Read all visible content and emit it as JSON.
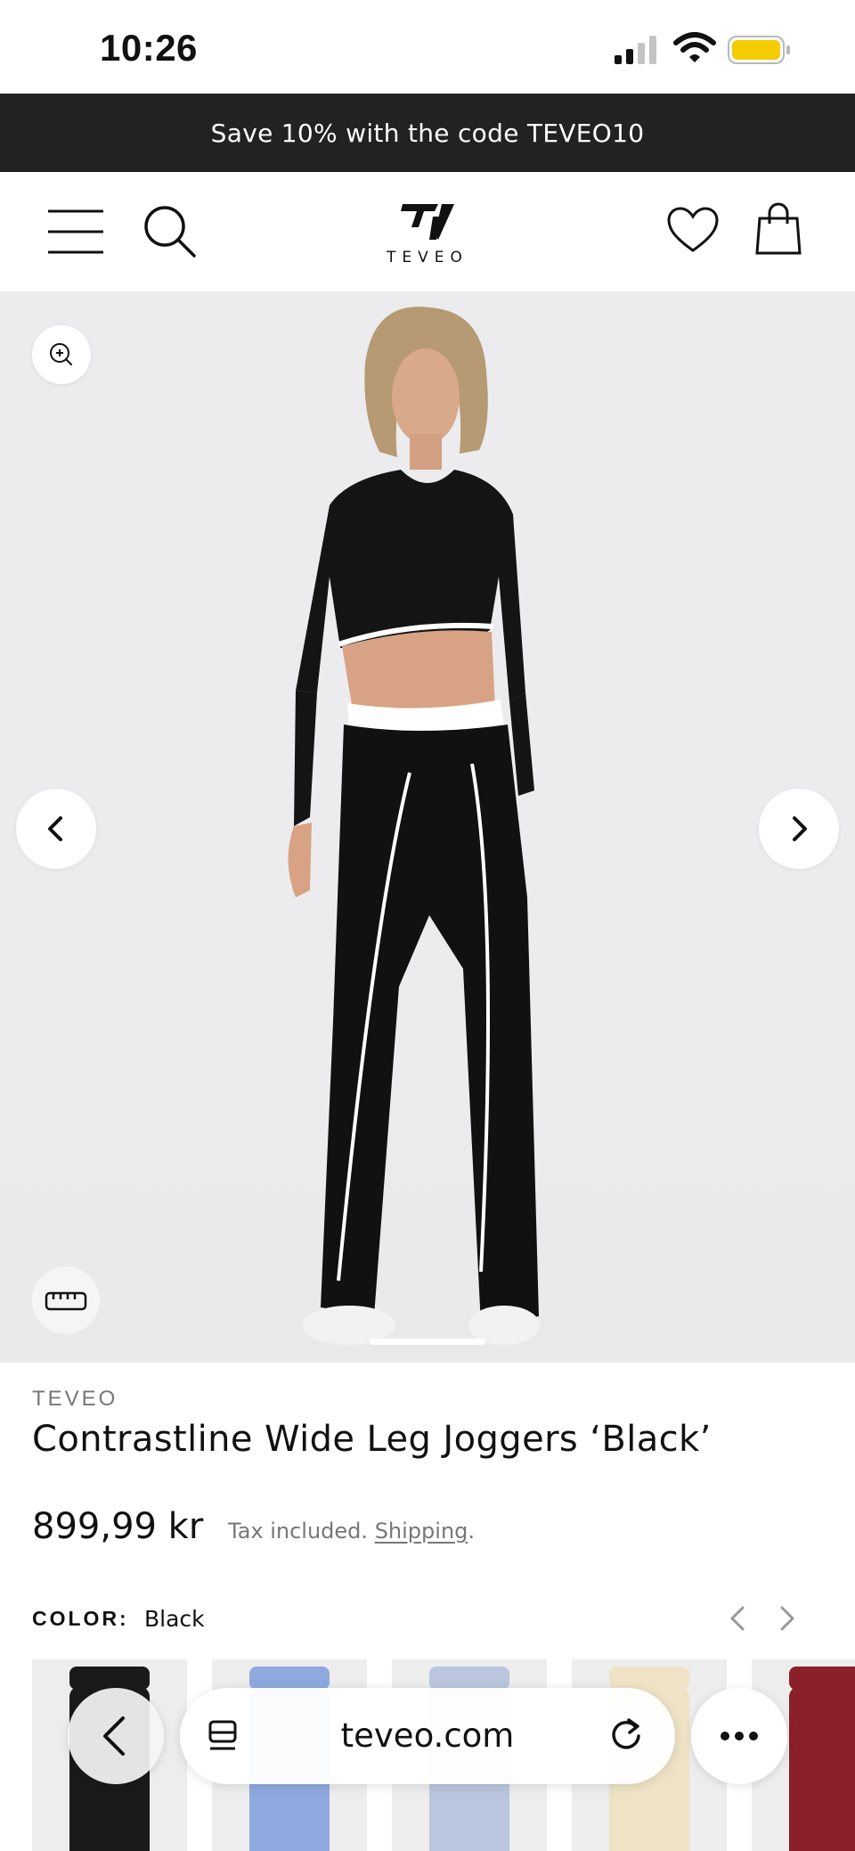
{
  "status_bar": {
    "time": "10:26",
    "battery_color": "#f5cc00"
  },
  "promo": {
    "text": "Save 10% with the code TEVEO10"
  },
  "header": {
    "logo_text": "TEVEO",
    "icons": [
      "menu-icon",
      "search-icon",
      "heart-icon",
      "shopping-bag-icon"
    ]
  },
  "gallery": {
    "icons": [
      "zoom-in-icon",
      "chevron-left-icon",
      "chevron-right-icon",
      "ruler-icon"
    ],
    "pager": {
      "current": 1
    }
  },
  "product": {
    "brand": "TEVEO",
    "title": "Contrastline Wide Leg Joggers ‘Black’",
    "price": "899,99 kr",
    "tax_text": "Tax included.",
    "shipping_link": "Shipping",
    "tax_suffix": "."
  },
  "color_selector": {
    "label": "COLOR:",
    "selected": "Black",
    "swatch_colors": [
      "#1a1a1a",
      "#8fa8e0",
      "#b9c6dd",
      "#efe3c6",
      "#8b1f2a"
    ]
  },
  "browser": {
    "url": "teveo.com",
    "icons": [
      "back-arrow-icon",
      "tabs-icon",
      "reload-icon",
      "more-icon"
    ]
  },
  "colors": {
    "promo_background": "#222222",
    "page_background": "#ffffff",
    "gallery_background": "#ececee",
    "muted_text": "#777777"
  }
}
